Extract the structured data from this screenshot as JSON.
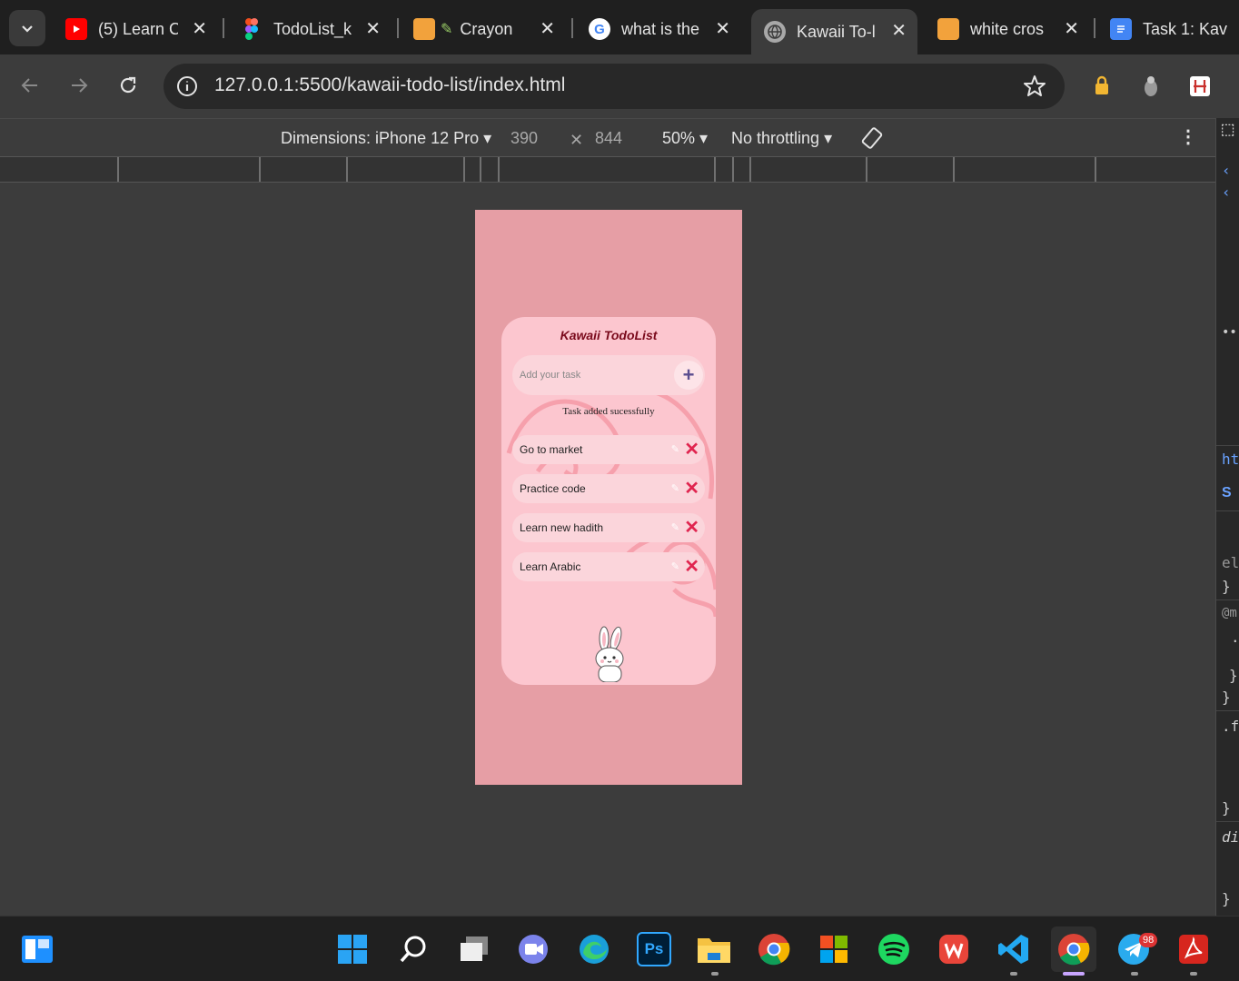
{
  "browser": {
    "tabs": [
      {
        "title": "(5) Learn C",
        "favicon": "youtube-icon"
      },
      {
        "title": "TodoList_k",
        "favicon": "figma-icon"
      },
      {
        "title": "Crayon",
        "favicon": "crayon-icon"
      },
      {
        "title": "what is the",
        "favicon": "google-icon"
      },
      {
        "title": "Kawaii To-l",
        "favicon": "globe-icon"
      },
      {
        "title": "white cros",
        "favicon": "crayon-icon"
      },
      {
        "title": "Task 1: Kav",
        "favicon": "docs-icon"
      }
    ],
    "url": "127.0.0.1:5500/kawaii-todo-list/index.html"
  },
  "devtools": {
    "device_label": "Dimensions: iPhone 12 Pro",
    "width": "390",
    "height": "844",
    "zoom": "50%",
    "throttling": "No throttling",
    "side_text": [
      "ht",
      "S",
      "el",
      "}",
      "@m",
      ".",
      "}",
      "}",
      ".f",
      "}",
      "di",
      "}"
    ]
  },
  "app": {
    "title": "Kawaii TodoList",
    "input_placeholder": "Add your task",
    "add_label": "+",
    "toast": "Task added sucessfully",
    "tasks": [
      "Go to market",
      "Practice code",
      "Learn new hadith",
      "Learn Arabic"
    ],
    "delete_label": "✕",
    "edit_label": "✎"
  },
  "taskbar": {
    "telegram_badge": "98",
    "apps": [
      "start-icon",
      "search-icon",
      "task-view-icon",
      "chat-icon",
      "edge-icon",
      "photoshop-icon",
      "file-explorer-icon",
      "chrome-icon",
      "microsoft-store-icon",
      "spotify-icon",
      "wps-icon",
      "vscode-icon",
      "chrome-icon",
      "telegram-icon",
      "acrobat-icon"
    ]
  },
  "colors": {
    "phone_bg": "#e69ea5",
    "card_bg": "#fcc6cf",
    "title": "#7a0a1c",
    "delete": "#e0254f"
  }
}
